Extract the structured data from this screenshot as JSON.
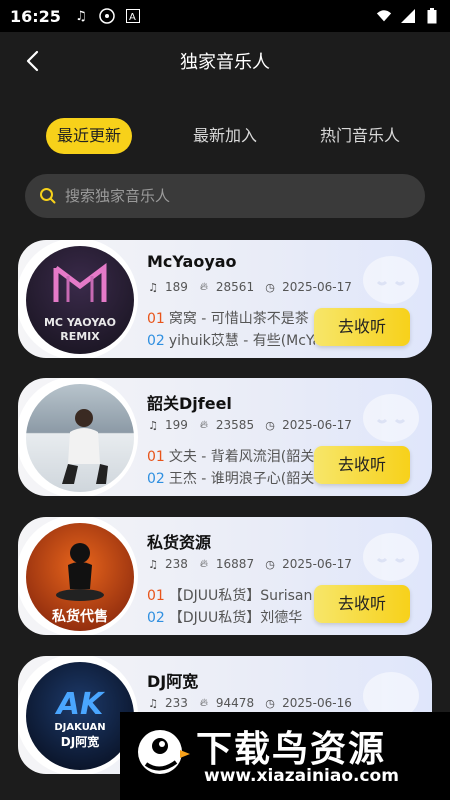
{
  "status_bar": {
    "time": "16:25"
  },
  "header": {
    "title": "独家音乐人"
  },
  "tabs": [
    {
      "label": "最近更新",
      "active": true
    },
    {
      "label": "最新加入",
      "active": false
    },
    {
      "label": "热门音乐人",
      "active": false
    }
  ],
  "search": {
    "placeholder": "搜索独家音乐人"
  },
  "cards": [
    {
      "name": "McYaoyao",
      "songs": "189",
      "plays": "28561",
      "date": "2025-06-17",
      "track1_num": "01",
      "track1": "窝窝 - 可惜山茶不是茶",
      "track2_num": "02",
      "track2": "yihuik苡慧 - 有些(McYa",
      "button": "去收听",
      "avatar_text": "MC YAOYAO REMIX"
    },
    {
      "name": "韶关Djfeel",
      "songs": "199",
      "plays": "23585",
      "date": "2025-06-17",
      "track1_num": "01",
      "track1": "文夫 - 背着风流泪(韶关",
      "track2_num": "02",
      "track2": "王杰 - 谁明浪子心(韶关",
      "button": "去收听"
    },
    {
      "name": "私货资源",
      "songs": "238",
      "plays": "16887",
      "date": "2025-06-17",
      "track1_num": "01",
      "track1": "【DJUU私货】Surisan",
      "track2_num": "02",
      "track2": "【DJUU私货】刘德华",
      "button": "去收听",
      "avatar_text": "私货代售"
    },
    {
      "name": "DJ阿宽",
      "songs": "233",
      "plays": "94478",
      "date": "2025-06-16",
      "avatar_text": "DJAKUAN DJ阿宽"
    }
  ],
  "banner": {
    "title": "下载鸟资源",
    "url": "www.xiazainiao.com"
  }
}
